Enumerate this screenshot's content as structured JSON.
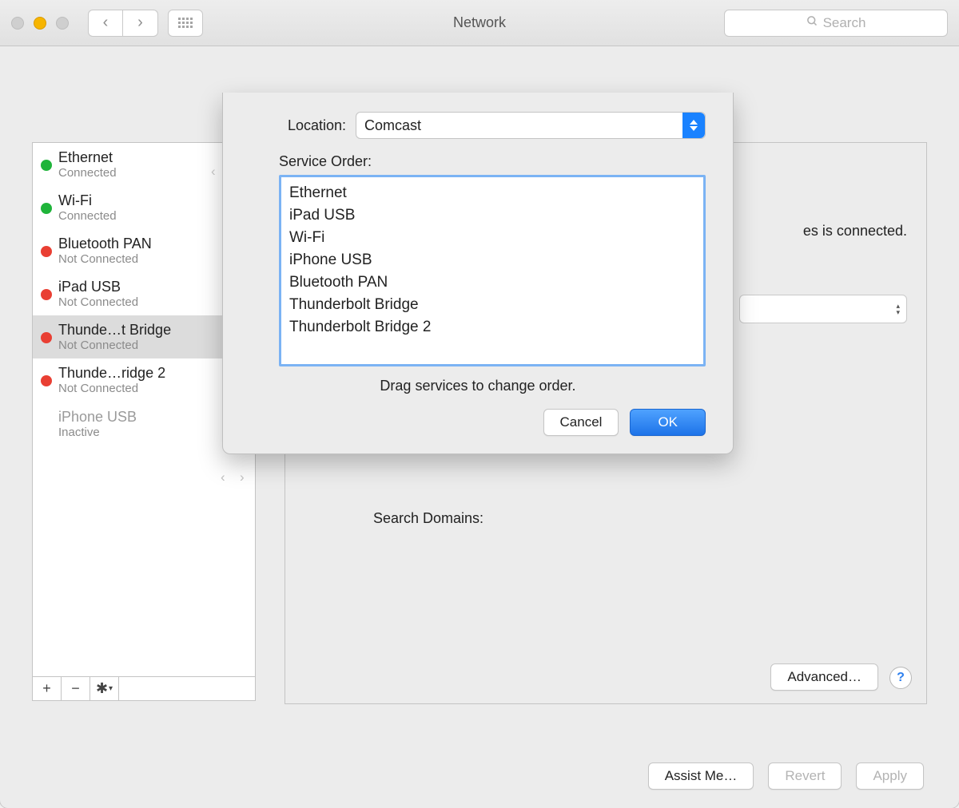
{
  "window": {
    "title": "Network",
    "search_placeholder": "Search"
  },
  "sidebar": {
    "items": [
      {
        "name": "Ethernet",
        "status": "Connected",
        "dot": "green"
      },
      {
        "name": "Wi-Fi",
        "status": "Connected",
        "dot": "green"
      },
      {
        "name": "Bluetooth PAN",
        "status": "Not Connected",
        "dot": "red"
      },
      {
        "name": "iPad USB",
        "status": "Not Connected",
        "dot": "red"
      },
      {
        "name": "Thunde…t Bridge",
        "status": "Not Connected",
        "dot": "red",
        "selected": true
      },
      {
        "name": "Thunde…ridge 2",
        "status": "Not Connected",
        "dot": "red"
      },
      {
        "name": "iPhone USB",
        "status": "Inactive",
        "dot": "none",
        "inactive": true
      }
    ]
  },
  "main": {
    "status_fragment": "es is connected.",
    "search_domains_label": "Search Domains:",
    "advanced_label": "Advanced…",
    "help_label": "?"
  },
  "bottom": {
    "assist": "Assist Me…",
    "revert": "Revert",
    "apply": "Apply"
  },
  "sheet": {
    "location_label": "Location:",
    "location_value": "Comcast",
    "service_order_label": "Service Order:",
    "services": [
      "Ethernet",
      "iPad USB",
      "Wi-Fi",
      "iPhone USB",
      "Bluetooth PAN",
      "Thunderbolt Bridge",
      "Thunderbolt Bridge 2"
    ],
    "hint": "Drag services to change order.",
    "cancel": "Cancel",
    "ok": "OK"
  }
}
